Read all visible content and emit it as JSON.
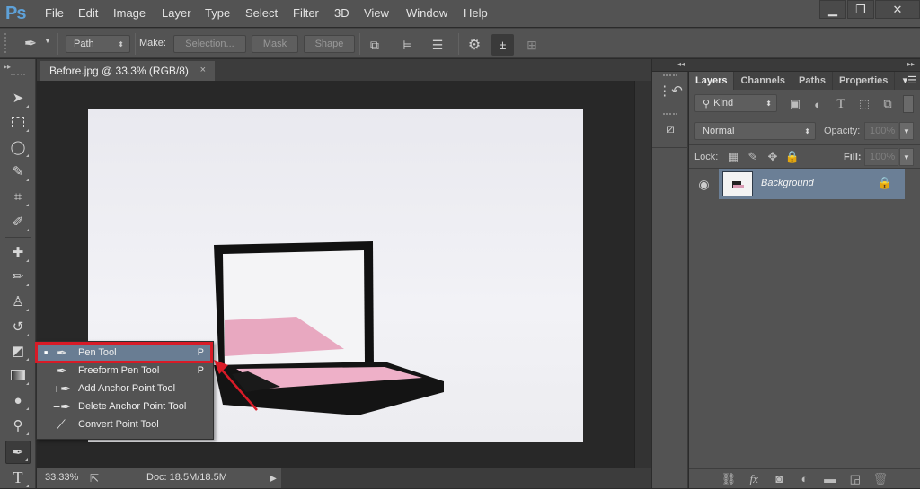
{
  "app": {
    "logo": "Ps",
    "menu": [
      "File",
      "Edit",
      "Image",
      "Layer",
      "Type",
      "Select",
      "Filter",
      "3D",
      "View",
      "Window",
      "Help"
    ],
    "window_controls": {
      "minimize": "minimize-icon",
      "restore": "restore-icon",
      "close": "close-icon"
    }
  },
  "options_bar": {
    "tool_icon": "pen-icon",
    "mode_select": "Path",
    "make_label": "Make:",
    "selection_button": "Selection...",
    "mask_button": "Mask",
    "shape_button": "Shape",
    "icons": [
      "path-operations-icon",
      "path-alignment-icon",
      "path-arrangement-icon",
      "gear-icon",
      "auto-add-delete-icon",
      "align-edges-icon"
    ]
  },
  "document": {
    "tab_title": "Before.jpg @ 33.3% (RGB/8)",
    "tab_close": "×",
    "image_subject": "open pink blush compact with mirror"
  },
  "status_bar": {
    "zoom": "33.33%",
    "doc_info": "Doc: 18.5M/18.5M"
  },
  "tools": [
    {
      "name": "move-tool",
      "glyph": "▸✥"
    },
    {
      "name": "rectangular-marquee-tool",
      "glyph": "⬚"
    },
    {
      "name": "lasso-tool",
      "glyph": "◯"
    },
    {
      "name": "quick-selection-tool",
      "glyph": "✎"
    },
    {
      "name": "crop-tool",
      "glyph": "⌗"
    },
    {
      "name": "eyedropper-tool",
      "glyph": "✒"
    },
    {
      "name": "spot-healing-brush-tool",
      "glyph": "✚"
    },
    {
      "name": "brush-tool",
      "glyph": "🖌"
    },
    {
      "name": "clone-stamp-tool",
      "glyph": "♙"
    },
    {
      "name": "history-brush-tool",
      "glyph": "↺"
    },
    {
      "name": "eraser-tool",
      "glyph": "◩"
    },
    {
      "name": "gradient-tool",
      "glyph": "▭"
    },
    {
      "name": "blur-tool",
      "glyph": "💧"
    },
    {
      "name": "dodge-tool",
      "glyph": "⚲"
    },
    {
      "name": "pen-tool",
      "glyph": "✒"
    },
    {
      "name": "type-tool",
      "glyph": "T"
    }
  ],
  "flyout": {
    "items": [
      {
        "label": "Pen Tool",
        "shortcut": "P",
        "active": true,
        "icon": "✒"
      },
      {
        "label": "Freeform Pen Tool",
        "shortcut": "P",
        "active": false,
        "icon": "✒"
      },
      {
        "label": "Add Anchor Point Tool",
        "shortcut": "",
        "active": false,
        "icon": "+✒"
      },
      {
        "label": "Delete Anchor Point Tool",
        "shortcut": "",
        "active": false,
        "icon": "−✒"
      },
      {
        "label": "Convert Point Tool",
        "shortcut": "",
        "active": false,
        "icon": "⟋"
      }
    ],
    "highlight_color": "#d81b27"
  },
  "layers_panel": {
    "tabs": [
      "Layers",
      "Channels",
      "Paths",
      "Properties"
    ],
    "active_tab": "Layers",
    "filter_kind": "Kind",
    "blend_mode": "Normal",
    "opacity_label": "Opacity:",
    "opacity_value": "100%",
    "lock_label": "Lock:",
    "fill_label": "Fill:",
    "fill_value": "100%",
    "layers": [
      {
        "name": "Background",
        "visible": true,
        "locked": true,
        "selected": true
      }
    ],
    "selected_color": "#6b7f96"
  }
}
